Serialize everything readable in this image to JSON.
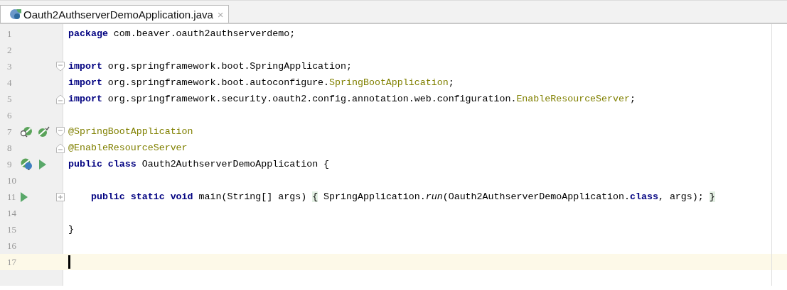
{
  "tabs": [
    {
      "label": "Oauth2AuthserverDemoApplication.java",
      "close": "×",
      "selected": true
    }
  ],
  "editor": {
    "lines": [
      {
        "number": "1",
        "tokens": [
          {
            "kind": "keyword",
            "text": "package"
          },
          {
            "kind": "plain",
            "text": " com.beaver.oauth2authserverdemo;"
          }
        ]
      },
      {
        "number": "2"
      },
      {
        "number": "3",
        "fold": {
          "kind": "start"
        },
        "tokens": [
          {
            "kind": "keyword",
            "text": "import"
          },
          {
            "kind": "plain",
            "text": " org.springframework.boot.SpringApplication;"
          }
        ]
      },
      {
        "number": "4",
        "tokens": [
          {
            "kind": "keyword",
            "text": "import"
          },
          {
            "kind": "plain",
            "text": " org.springframework.boot.autoconfigure."
          },
          {
            "kind": "annotation",
            "text": "SpringBootApplication"
          },
          {
            "kind": "plain",
            "text": ";"
          }
        ]
      },
      {
        "number": "5",
        "fold": {
          "kind": "end"
        },
        "tokens": [
          {
            "kind": "keyword",
            "text": "import"
          },
          {
            "kind": "plain",
            "text": " org.springframework.security.oauth2.config.annotation.web.configuration."
          },
          {
            "kind": "annotation",
            "text": "EnableResourceServer"
          },
          {
            "kind": "plain",
            "text": ";"
          }
        ]
      },
      {
        "number": "6"
      },
      {
        "number": "7",
        "fold": {
          "kind": "start"
        },
        "gutter": [
          {
            "kind": "bean-search"
          },
          {
            "kind": "bean-check"
          }
        ],
        "tokens": [
          {
            "kind": "annotation",
            "text": "@SpringBootApplication"
          }
        ]
      },
      {
        "number": "8",
        "fold": {
          "kind": "end"
        },
        "tokens": [
          {
            "kind": "annotation",
            "text": "@EnableResourceServer"
          }
        ]
      },
      {
        "number": "9",
        "gutter": [
          {
            "kind": "bean-class"
          },
          {
            "kind": "run"
          }
        ],
        "tokens": [
          {
            "kind": "keyword",
            "text": "public class"
          },
          {
            "kind": "plain",
            "text": " Oauth2AuthserverDemoApplication {"
          }
        ]
      },
      {
        "number": "10"
      },
      {
        "number": "11",
        "fold": {
          "kind": "collapsed"
        },
        "gutter": [
          {
            "kind": "run"
          }
        ],
        "tokens": [
          {
            "kind": "keyword",
            "text": "    public static void"
          },
          {
            "kind": "plain",
            "text": " main(String[] args) "
          },
          {
            "kind": "folded",
            "text": "{"
          },
          {
            "kind": "plain",
            "text": " SpringApplication."
          },
          {
            "kind": "italic",
            "text": "run"
          },
          {
            "kind": "plain",
            "text": "(Oauth2AuthserverDemoApplication."
          },
          {
            "kind": "keyword",
            "text": "class"
          },
          {
            "kind": "plain",
            "text": ", args); "
          },
          {
            "kind": "folded",
            "text": "}"
          }
        ]
      },
      {
        "number": "14"
      },
      {
        "number": "15",
        "tokens": [
          {
            "kind": "plain",
            "text": "}"
          }
        ]
      },
      {
        "number": "16"
      },
      {
        "number": "17",
        "current": true,
        "caret": true
      }
    ]
  }
}
